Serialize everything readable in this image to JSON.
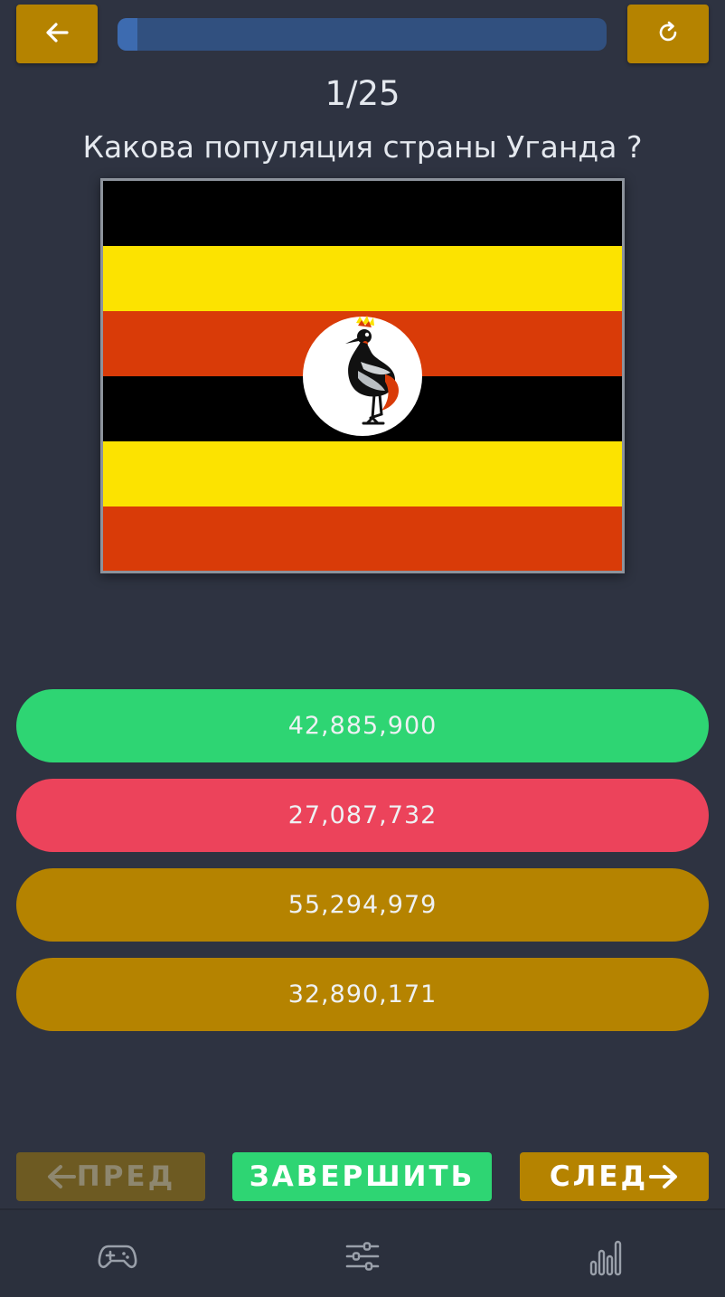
{
  "header": {
    "progress": 0.04,
    "counter": "1/25"
  },
  "question": {
    "text": "Какова популяция страны Уганда ?",
    "flag": "uganda-flag"
  },
  "answers": [
    {
      "label": "42,885,900",
      "state": "correct",
      "color": "#2ed573"
    },
    {
      "label": "27,087,732",
      "state": "wrong",
      "color": "#ec435b"
    },
    {
      "label": "55,294,979",
      "state": "default",
      "color": "#b58300"
    },
    {
      "label": "32,890,171",
      "state": "default",
      "color": "#b58300"
    }
  ],
  "nav": {
    "prev_label": "ПРЕД",
    "finish_label": "ЗАВЕРШИТЬ",
    "next_label": "СЛЕД"
  },
  "bottom_tabs": [
    {
      "icon": "gamepad-icon"
    },
    {
      "icon": "sliders-icon"
    },
    {
      "icon": "bar-chart-icon"
    }
  ],
  "colors": {
    "background": "#2e3341",
    "accent": "#b58300",
    "correct": "#2ed573",
    "wrong": "#ec435b",
    "progress_track": "#31507f"
  }
}
